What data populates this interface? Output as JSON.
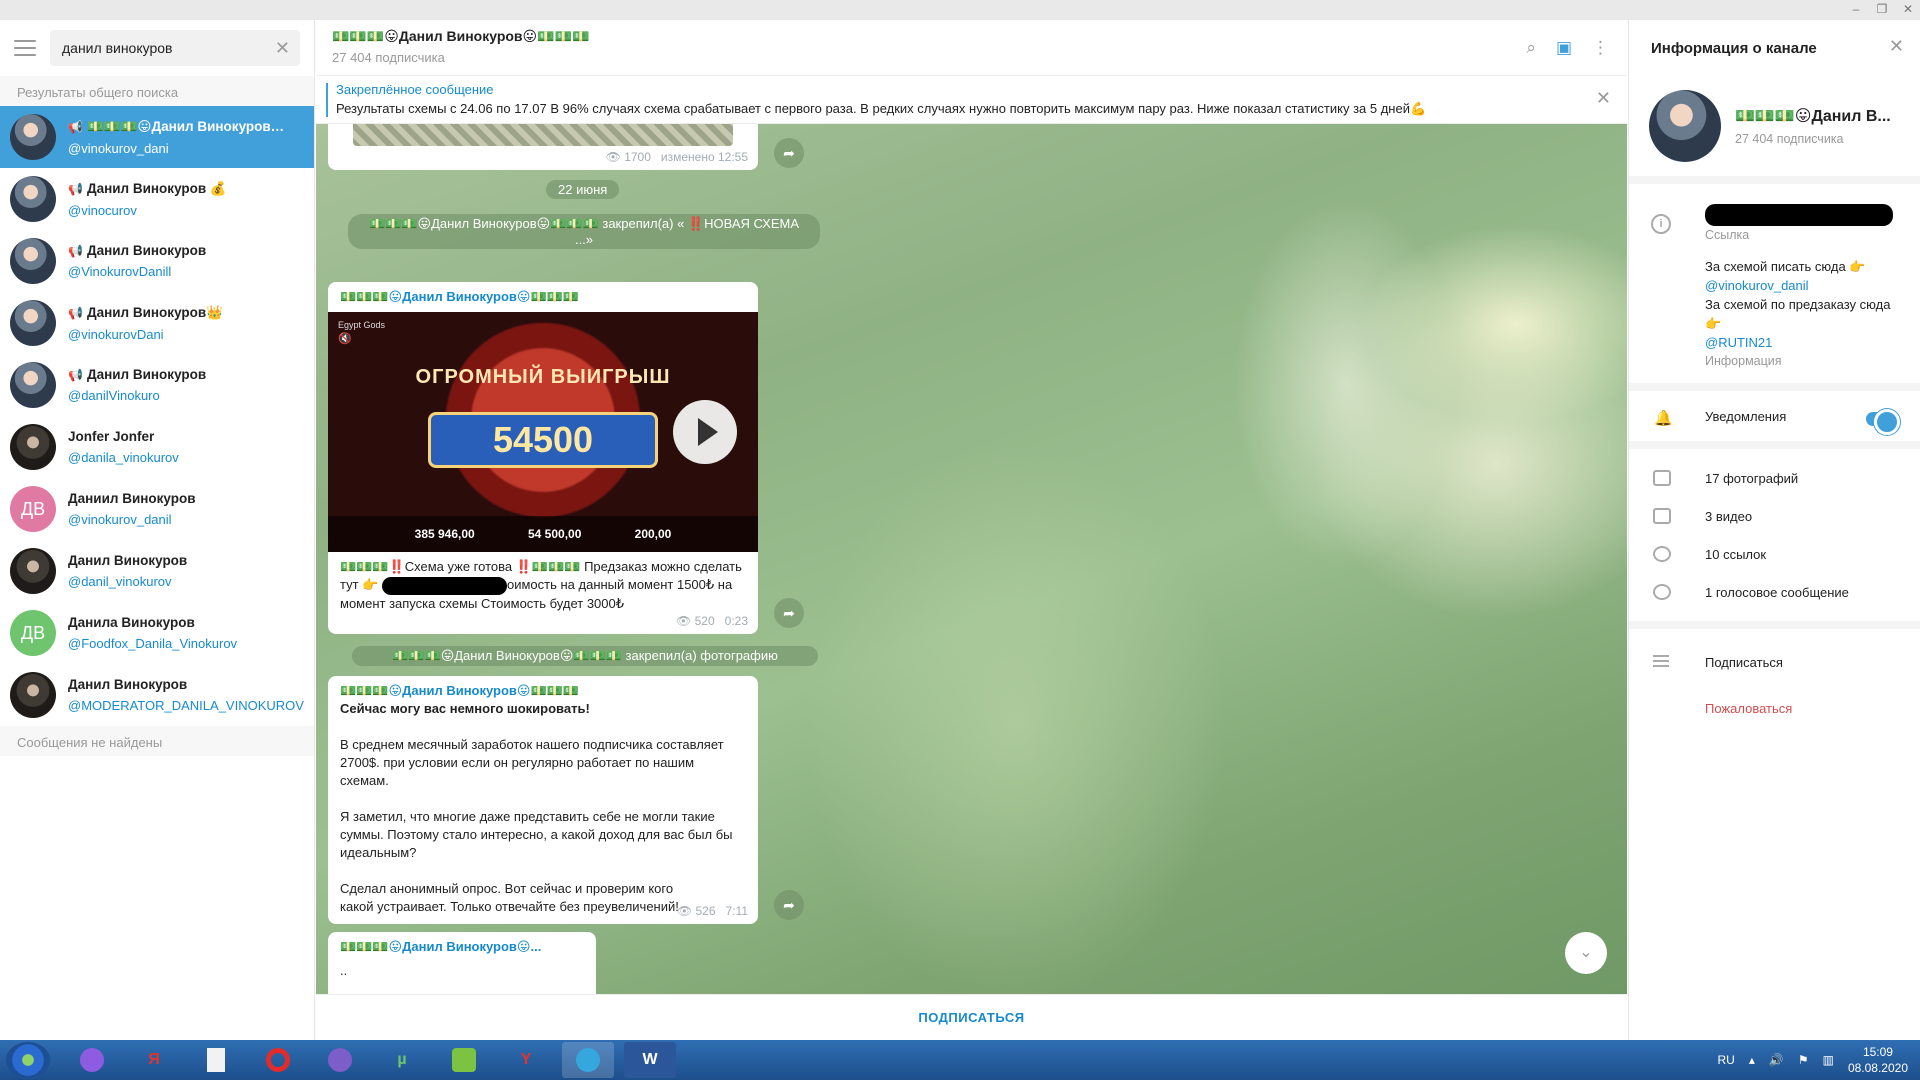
{
  "left": {
    "search_value": "данил винокуров",
    "section_global": "Результаты общего поиска",
    "no_messages": "Сообщения не найдены",
    "chats": [
      {
        "name": "💵💵💵😛Данил Винокуров…",
        "handle": "@vinokurov_dani",
        "channel": true
      },
      {
        "name": "Данил Винокуров 💰",
        "handle": "@vinocurov",
        "channel": true
      },
      {
        "name": "Данил Винокуров",
        "handle": "@VinokurovDanill",
        "channel": true
      },
      {
        "name": "Данил Винокуров👑",
        "handle": "@vinokurovDani",
        "channel": true
      },
      {
        "name": "Данил Винокуров",
        "handle": "@danilVinokuro",
        "channel": true
      },
      {
        "name": "Jonfer Jonfer",
        "handle": "@danila_vinokurov",
        "channel": false
      },
      {
        "name": "Даниил Винокуров",
        "handle": "@vinokurov_danil",
        "channel": false,
        "initials": "ДВ"
      },
      {
        "name": "Данил Винокуров",
        "handle": "@danil_vinokurov",
        "channel": false
      },
      {
        "name": "Данила Винокуров",
        "handle": "@Foodfox_Danila_Vinokurov",
        "channel": false,
        "initials": "ДВ"
      },
      {
        "name": "Данил Винокуров",
        "handle": "@MODERATOR_DANILA_VINOKUROV",
        "channel": false
      }
    ]
  },
  "header": {
    "title": "💵💵💵😛Данил Винокуров😛💵💵💵",
    "subs": "27 404 подписчика"
  },
  "pinned": {
    "title": "Закреплённое сообщение",
    "text": "Результаты схемы с 24.06 по 17.07 В 96% случаях схема срабатывает с первого раза. В редких случаях нужно повторить максимум пару раз. Ниже показал статистику за 5 дней💪"
  },
  "messages": {
    "top_meta_views": "1700",
    "top_meta_time": "изменено 12:55",
    "date": "22 июня",
    "service1": "💵💵💵😛Данил Винокуров😛💵💵💵 закрепил(а) « ‼️НОВАЯ СХЕМА ...»",
    "video_msg_from": "💵💵💵😛Данил Винокуров😛💵💵💵",
    "video_label": "Egypt Gods",
    "video_banner": "ОГРОМНЫЙ ВЫИГРЫШ",
    "video_amount": "54500",
    "video_balance": "385 946,00",
    "video_total": "54 500,00",
    "video_bet": "200,00",
    "video_text_1": "💵💵💵‼️Схема уже готова ‼️💵💵💵 Предзаказ можно сделать тут 👉",
    "video_text_2": "оимость на данный момент 1500₺ на момент запуска схемы Стоимость будет 3000₺",
    "video_views": "520",
    "video_time": "0:23",
    "service2": "💵💵💵😛Данил Винокуров😛💵💵💵 закрепил(а) фотографию",
    "text_msg_from": "💵💵💵😛Данил Винокуров😛💵💵💵",
    "text_bold": "Сейчас могу вас немного шокировать!",
    "text_p1": "В среднем месячный заработок нашего подписчика составляет 2700$. при условии если он регулярно работает по нашим схемам.",
    "text_p2": "Я заметил, что многие даже представить себе не могли такие суммы. Поэтому стало интересно, а какой доход для вас был бы идеальным?",
    "text_p3": "Сделал анонимный опрос. Вот сейчас и проверим кого какой устраивает. Только отвечайте без преувеличений!",
    "text_views": "526",
    "text_time": "7:11",
    "last_from": "💵💵💵😛Данил Винокуров😛...",
    "last_text": ".."
  },
  "subscribe_label": "ПОДПИСАТЬСЯ",
  "right": {
    "title": "Информация о канале",
    "name": "💵💵💵😛Данил В...",
    "subs": "27 404 подписчика",
    "link_label": "Ссылка",
    "info_line1": "За схемой писать сюда 👉",
    "info_handle1": "@vinokurov_danil",
    "info_line2": "За схемой по предзаказу сюда👉",
    "info_handle2": "@RUTIN21",
    "info_label": "Информация",
    "notifications": "Уведомления",
    "photos": "17 фотографий",
    "videos": "3 видео",
    "links": "10 ссылок",
    "voice": "1 голосовое сообщение",
    "subscribe": "Подписаться",
    "report": "Пожаловаться"
  },
  "taskbar": {
    "lang": "RU",
    "time": "15:09",
    "date": "08.08.2020"
  },
  "colors": {
    "accent": "#419fd9",
    "link": "#168acd",
    "danger": "#d14e4e"
  }
}
